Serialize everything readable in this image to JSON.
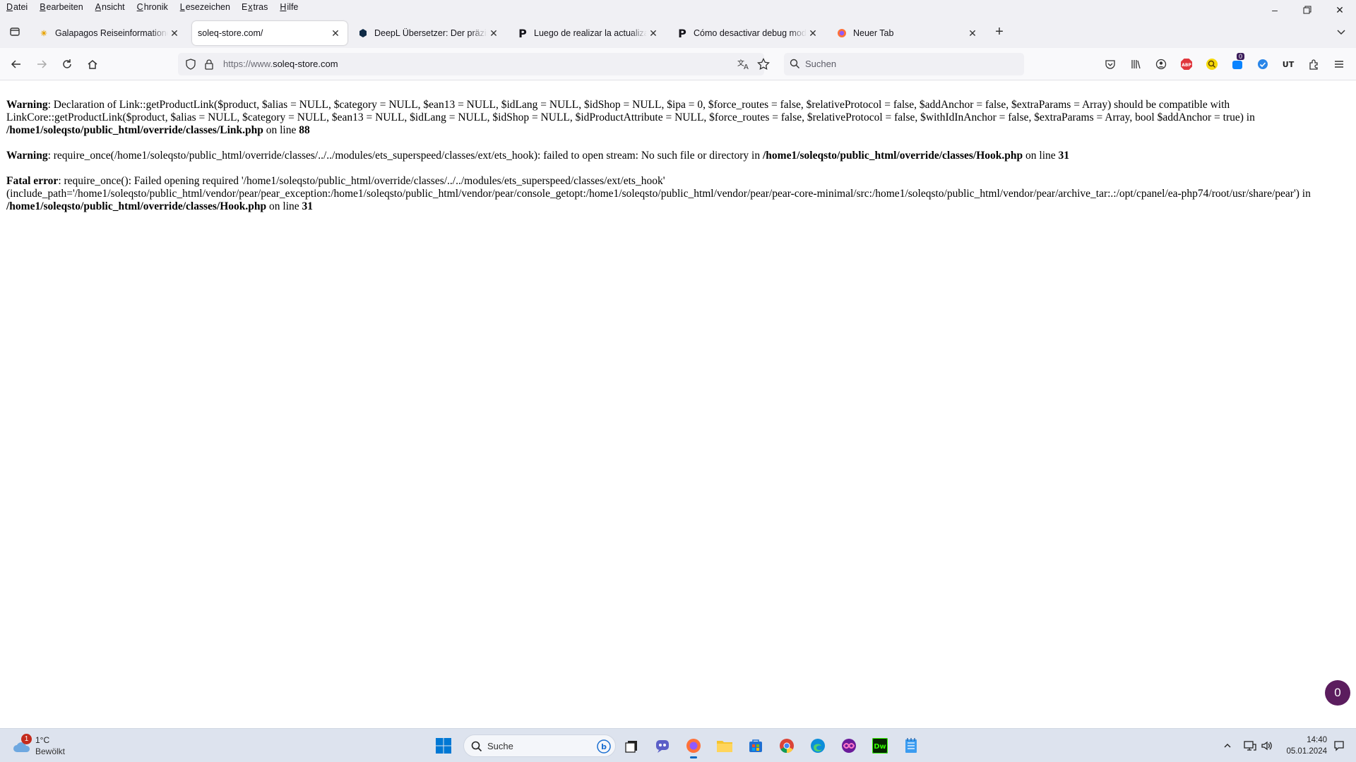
{
  "menu": [
    {
      "pre": "",
      "key": "D",
      "post": "atei"
    },
    {
      "pre": "",
      "key": "B",
      "post": "earbeiten"
    },
    {
      "pre": "",
      "key": "A",
      "post": "nsicht"
    },
    {
      "pre": "",
      "key": "C",
      "post": "hronik"
    },
    {
      "pre": "",
      "key": "L",
      "post": "esezeichen"
    },
    {
      "pre": "E",
      "key": "x",
      "post": "tras"
    },
    {
      "pre": "",
      "key": "H",
      "post": "ilfe"
    }
  ],
  "tabs": [
    {
      "label": "Galapagos Reiseinformationen - Ga"
    },
    {
      "label": "soleq-store.com/"
    },
    {
      "label": "DeepL Übersetzer: Der präziseste"
    },
    {
      "label": "Luego de realizar la actualización"
    },
    {
      "label": "Cómo desactivar debug mode en"
    },
    {
      "label": "Neuer Tab"
    }
  ],
  "nav": {
    "url_prefix": "https://www.",
    "url_host": "soleq-store.com",
    "search_placeholder": "Suchen",
    "extension_badge": "0"
  },
  "errors": {
    "e1_type": "Warning",
    "e1_text": ": Declaration of Link::getProductLink($product, $alias = NULL, $category = NULL, $ean13 = NULL, $idLang = NULL, $idShop = NULL, $ipa = 0, $force_routes = false, $relativeProtocol = false, $addAnchor = false, $extraParams = Array) should be compatible with LinkCore::getProductLink($product, $alias = NULL, $category = NULL, $ean13 = NULL, $idLang = NULL, $idShop = NULL, $idProductAttribute = NULL, $force_routes = false, $relativeProtocol = false, $withIdInAnchor = false, $extraParams = Array, bool $addAnchor = true) in ",
    "e1_file": "/home1/soleqsto/public_html/override/classes/Link.php",
    "e1_online": " on line ",
    "e1_line": "88",
    "e2_type": "Warning",
    "e2_text": ": require_once(/home1/soleqsto/public_html/override/classes/../../modules/ets_superspeed/classes/ext/ets_hook): failed to open stream: No such file or directory in ",
    "e2_file": "/home1/soleqsto/public_html/override/classes/Hook.php",
    "e2_online": " on line ",
    "e2_line": "31",
    "e3_type": "Fatal error",
    "e3_text": ": require_once(): Failed opening required '/home1/soleqsto/public_html/override/classes/../../modules/ets_superspeed/classes/ext/ets_hook' (include_path='/home1/soleqsto/public_html/vendor/pear/pear_exception:/home1/soleqsto/public_html/vendor/pear/console_getopt:/home1/soleqsto/public_html/vendor/pear/pear-core-minimal/src:/home1/soleqsto/public_html/vendor/pear/archive_tar:.:/opt/cpanel/ea-php74/root/usr/share/pear') in ",
    "e3_file": "/home1/soleqsto/public_html/override/classes/Hook.php",
    "e3_online": " on line ",
    "e3_line": "31"
  },
  "fab_label": "0",
  "taskbar": {
    "weather_badge": "1",
    "temp": "1°C",
    "condition": "Bewölkt",
    "search_placeholder": "Suche",
    "time": "14:40",
    "date": "05.01.2024"
  },
  "icons": [
    "tab-overview-icon",
    "back-icon",
    "forward-icon",
    "reload-icon",
    "home-icon",
    "shield-icon",
    "lock-icon",
    "translate-icon",
    "star-icon",
    "search-icon",
    "pocket-icon",
    "library-icon",
    "account-icon",
    "extensions-icon",
    "menu-icon",
    "windows-icon",
    "widgets-icon",
    "chevron-up-icon",
    "network-icon",
    "volume-icon",
    "notification-icon"
  ]
}
